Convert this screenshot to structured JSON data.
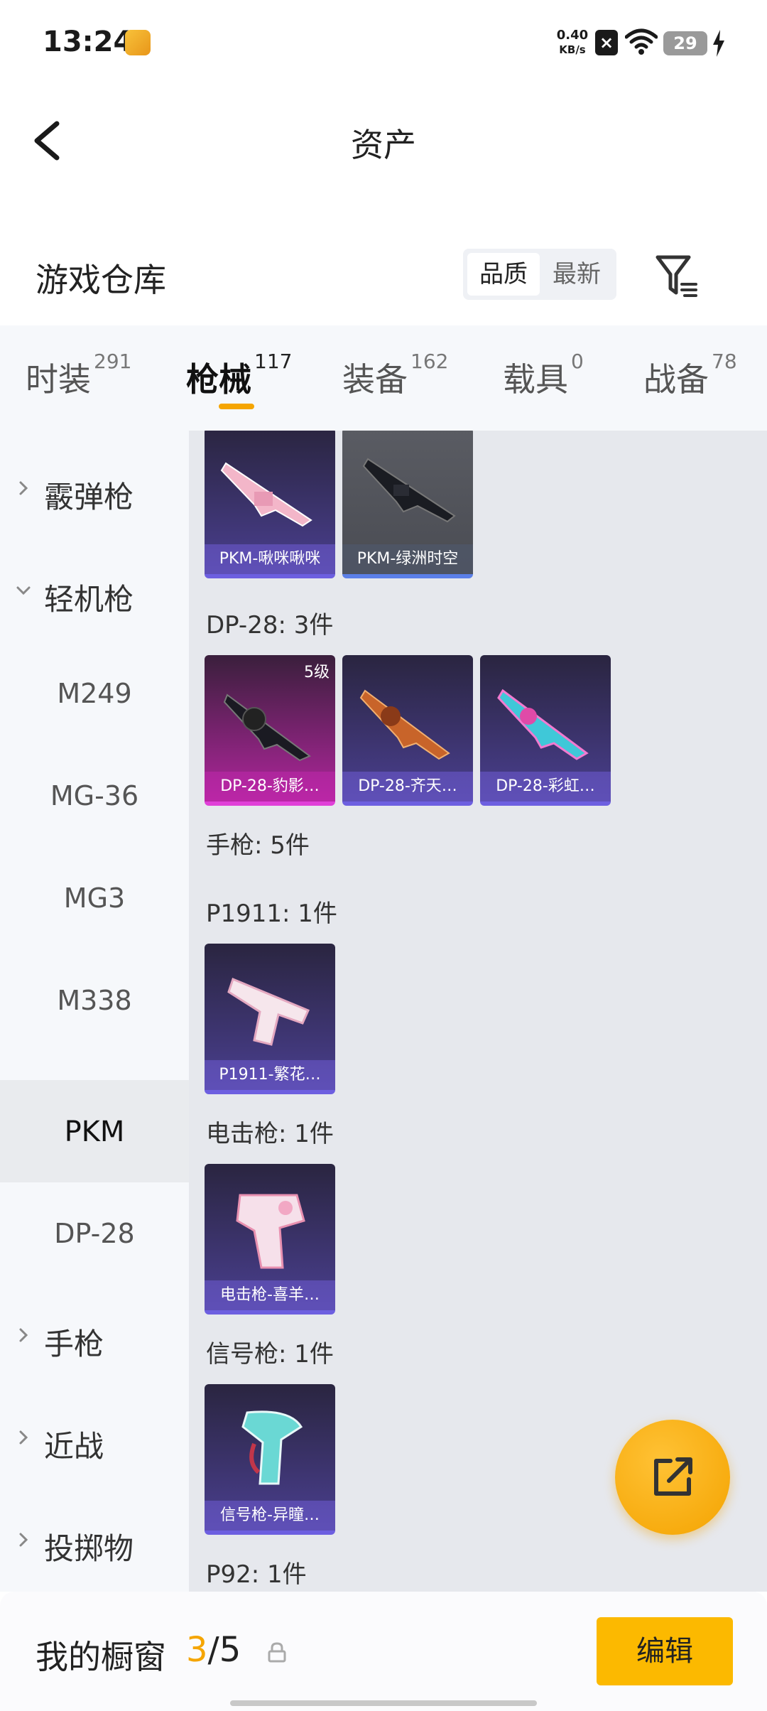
{
  "status_bar": {
    "time": "13:24",
    "speed_value": "0.40",
    "speed_unit": "KB/s",
    "battery": "29",
    "icons": [
      "app-icon",
      "close-box-icon",
      "wifi-icon",
      "battery-icon",
      "charging-bolt-icon"
    ]
  },
  "header": {
    "title": "资产",
    "back_icon": "chevron-left-icon"
  },
  "warehouse": {
    "title": "游戏仓库",
    "sort_options": [
      "品质",
      "最新"
    ],
    "sort_selected": "品质",
    "filter_icon": "filter-icon"
  },
  "tabs": [
    {
      "label": "时装",
      "count": "291"
    },
    {
      "label": "枪械",
      "count": "117"
    },
    {
      "label": "装备",
      "count": "162"
    },
    {
      "label": "载具",
      "count": "0"
    },
    {
      "label": "战备",
      "count": "78"
    }
  ],
  "active_tab": "枪械",
  "sidebar": {
    "items": [
      {
        "label": "霰弹枪",
        "type": "group",
        "expanded": false
      },
      {
        "label": "轻机枪",
        "type": "group",
        "expanded": true
      },
      {
        "label": "M249",
        "type": "sub"
      },
      {
        "label": "MG-36",
        "type": "sub"
      },
      {
        "label": "MG3",
        "type": "sub"
      },
      {
        "label": "M338",
        "type": "sub"
      },
      {
        "label": "PKM",
        "type": "sub",
        "selected": true
      },
      {
        "label": "DP-28",
        "type": "sub"
      },
      {
        "label": "手枪",
        "type": "group",
        "expanded": false
      },
      {
        "label": "近战",
        "type": "group",
        "expanded": false
      },
      {
        "label": "投掷物",
        "type": "group",
        "expanded": false
      }
    ]
  },
  "content": {
    "pkm_cards": [
      {
        "name": "PKM-啾咪啾咪",
        "quality": "purple"
      },
      {
        "name": "PKM-绿洲时空",
        "quality": "gray"
      }
    ],
    "dp28_label": "DP-28: 3件",
    "dp28_cards": [
      {
        "name": "DP-28-豹影…",
        "quality": "pink",
        "level": "5级"
      },
      {
        "name": "DP-28-齐天…",
        "quality": "purple"
      },
      {
        "name": "DP-28-彩虹…",
        "quality": "purple"
      }
    ],
    "pistol_label": "手枪: 5件",
    "p1911_label": "P1911: 1件",
    "p1911_cards": [
      {
        "name": "P1911-繁花…",
        "quality": "purple"
      }
    ],
    "stun_label": "电击枪: 1件",
    "stun_cards": [
      {
        "name": "电击枪-喜羊…",
        "quality": "purple"
      }
    ],
    "flare_label": "信号枪: 1件",
    "flare_cards": [
      {
        "name": "信号枪-异瞳…",
        "quality": "purple"
      }
    ],
    "p92_label": "P92: 1件"
  },
  "fab": {
    "icon": "share-external-icon"
  },
  "bottom_bar": {
    "title": "我的橱窗",
    "current": "3",
    "separator": "/",
    "total": "5",
    "lock_icon": "lock-icon",
    "edit_label": "编辑"
  },
  "colors": {
    "accent": "#f5a500",
    "button": "#fcb900",
    "card_purple": "#4a3f90",
    "card_pink": "#b0269c",
    "card_gray": "#5a5c63"
  }
}
